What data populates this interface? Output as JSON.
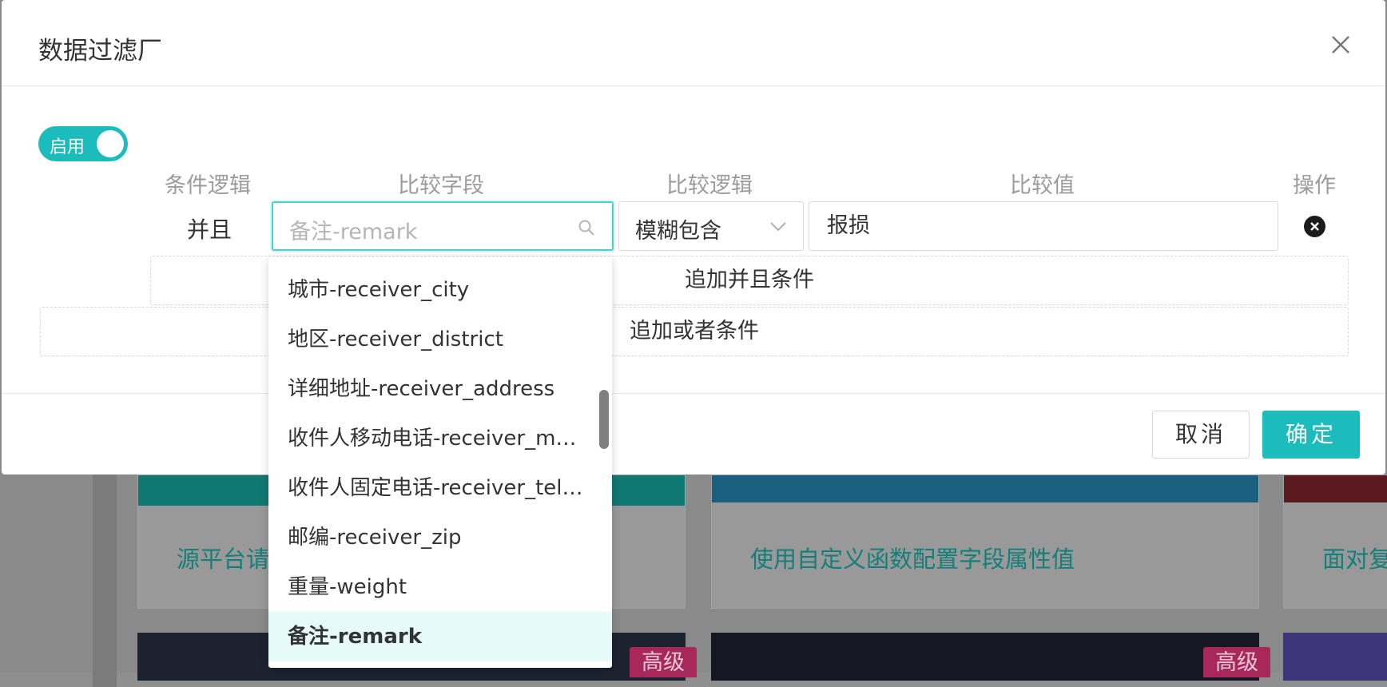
{
  "background": {
    "cards": [
      {
        "title": "源平台请",
        "banner_color": "#107873"
      },
      {
        "title": "使用自定义函数配置字段属性值",
        "banner_color": "#1b5f80"
      },
      {
        "title": "面对复",
        "banner_color": "#5a1a1f"
      }
    ],
    "badges": [
      "高级",
      "高级"
    ]
  },
  "modal": {
    "title": "数据过滤厂",
    "toggle_label": "启用",
    "columns": {
      "logic": "条件逻辑",
      "field": "比较字段",
      "operator": "比较逻辑",
      "value": "比较值",
      "action": "操作"
    },
    "row": {
      "logic": "并且",
      "field_placeholder": "备注-remark",
      "operator": "模糊包含",
      "value": "报损"
    },
    "add_and_label": "追加并且条件",
    "add_or_label": "追加或者条件",
    "cancel_label": "取消",
    "ok_label": "确定"
  },
  "dropdown": {
    "items": [
      "城市-receiver_city",
      "地区-receiver_district",
      "详细地址-receiver_address",
      "收件人移动电话-receiver_mobile",
      "收件人固定电话-receiver_telno",
      "邮编-receiver_zip",
      "重量-weight",
      "备注-remark"
    ],
    "selected_index": 7
  },
  "colors": {
    "accent": "#1dbcbc",
    "selected_bg": "#e6fbf9"
  }
}
